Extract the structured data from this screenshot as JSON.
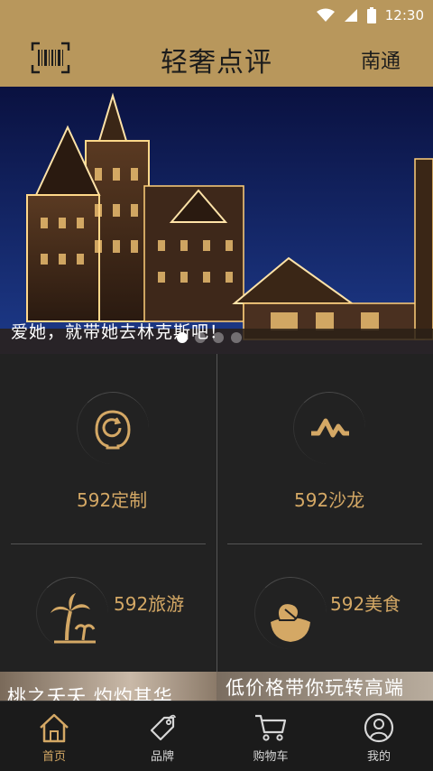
{
  "status_bar": {
    "time": "12:30"
  },
  "header": {
    "logo_text": "轻奢点评",
    "city": "南通"
  },
  "banner": {
    "caption": "爱她，就带她去林克斯吧！",
    "slide_count": 4,
    "active_slide": 1
  },
  "tiles": [
    {
      "label": "592定制",
      "icon": "custom-face-icon"
    },
    {
      "label": "592沙龙",
      "icon": "pulse-icon"
    },
    {
      "label": "592旅游",
      "icon": "palm-tree-icon"
    },
    {
      "label": "592美食",
      "icon": "food-bowl-icon"
    }
  ],
  "promo": {
    "left_text": "桃之夭夭 灼灼其华",
    "right_text": "低价格带你玩转高端"
  },
  "bottom_nav": [
    {
      "label": "首页",
      "icon": "home-icon",
      "active": true
    },
    {
      "label": "品牌",
      "icon": "tag-icon",
      "active": false
    },
    {
      "label": "购物车",
      "icon": "cart-icon",
      "active": false
    },
    {
      "label": "我的",
      "icon": "user-icon",
      "active": false
    }
  ],
  "colors": {
    "accent": "#b8975c",
    "gold_text": "#d4a865",
    "background": "#1f1f1f"
  }
}
